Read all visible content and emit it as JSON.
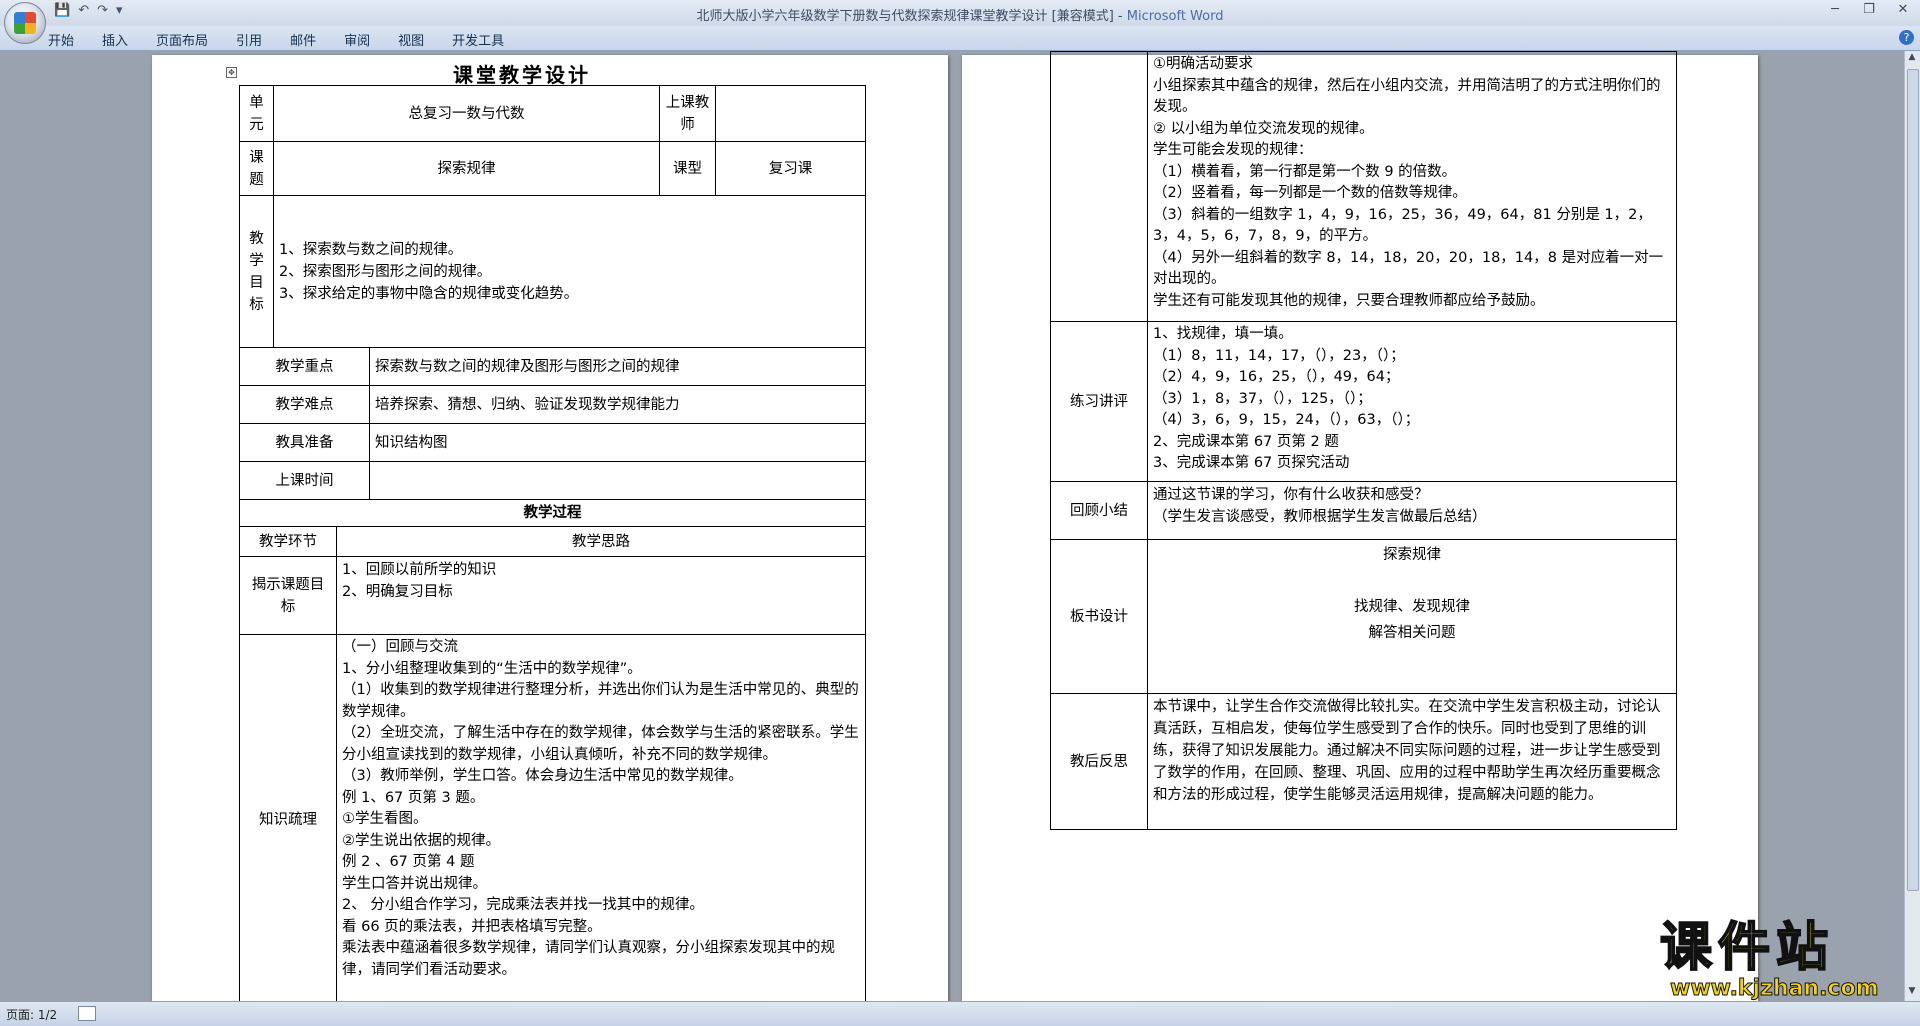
{
  "window": {
    "title": "北师大版小学六年级数学下册数与代数探索规律课堂教学设计 [兼容模式] - ",
    "app": "Microsoft Word"
  },
  "ribbon": {
    "tabs": [
      "开始",
      "插入",
      "页面布局",
      "引用",
      "邮件",
      "审阅",
      "视图",
      "开发工具"
    ]
  },
  "status": {
    "page": "页面: 1/2"
  },
  "watermark": {
    "brand": "课件站",
    "url": "www.kjzhan.com"
  },
  "doc": {
    "title": "课堂教学设计",
    "unit_label": "单元",
    "unit_value": "总复习一数与代数",
    "teacher_label": "上课教师",
    "topic_label": "课题",
    "topic_value": "探索规律",
    "type_label": "课型",
    "type_value": "复习课",
    "goal_label": "教学目标",
    "goals": [
      "1、探索数与数之间的规律。",
      "2、探索图形与图形之间的规律。",
      "3、探求给定的事物中隐含的规律或变化趋势。"
    ],
    "key_label": "教学重点",
    "key_value": "探索数与数之间的规律及图形与图形之间的规律",
    "difficult_label": "教学难点",
    "difficult_value": "培养探索、猜想、归纳、验证发现数学规律能力",
    "prep_label": "教具准备",
    "prep_value": "知识结构图",
    "time_label": "上课时间",
    "process_header": "教学过程",
    "stage_header": "教学环节",
    "idea_header": "教学思路",
    "s1_label": "揭示课题目标",
    "s1_lines": [
      "1、回顾以前所学的知识",
      "2、明确复习目标"
    ],
    "s2_label": "知识疏理",
    "s2_lines": [
      "（一）回顾与交流",
      "1、分小组整理收集到的“生活中的数学规律”。",
      "（1）收集到的数学规律进行整理分析，并选出你们认为是生活中常见的、典型的数学规律。",
      "（2）全班交流，了解生活中存在的数学规律，体会数学与生活的紧密联系。学生分小组宣读找到的数学规律，小组认真倾听，补充不同的数学规律。",
      "（3）教师举例，学生口答。体会身边生活中常见的数学规律。",
      "例 1、67 页第 3 题。",
      "①学生看图。",
      "②学生说出依据的规律。",
      "例 2 、67 页第 4 题",
      "学生口答并说出规律。",
      "2、 分小组合作学习，完成乘法表并找一找其中的规律。",
      "看 66 页的乘法表，并把表格填写完整。",
      "乘法表中蕴涵着很多数学规律，请同学们认真观察，分小组探索发现其中的规律，请同学们看活动要求。"
    ],
    "p2_first_lines": [
      "①明确活动要求",
      "小组探索其中蕴含的规律，然后在小组内交流，并用简洁明了的方式注明你们的发现。",
      "② 以小组为单位交流发现的规律。",
      "学生可能会发现的规律：",
      "（1）横着看，第一行都是第一个数 9 的倍数。",
      "（2）竖着看，每一列都是一个数的倍数等规律。",
      "（3）斜着的一组数字 1，4，9，16，25，36，49，64，81 分别是 1，2，3，4，5，6，7，8，9，的平方。",
      "（4）另外一组斜着的数字 8，14，18，20，20，18，14，8 是对应着一对一对出现的。",
      "学生还有可能发现其他的规律，只要合理教师都应给予鼓励。"
    ],
    "practice_label": "练习讲评",
    "practice_lines": [
      "1、找规律，填一填。",
      "（1）8，11，14，17，（），23，（）；",
      "（2）4，9，16，25，（），49，64；",
      "（3）1，8，37，（），125，（）；",
      "（4）3，6，9，15，24，（），63，（）；",
      "2、完成课本第 67 页第 2 题",
      "3、完成课本第 67 页探究活动"
    ],
    "review_label": "回顾小结",
    "review_lines": [
      "通过这节课的学习，你有什么收获和感受？",
      "（学生发言谈感受，教师根据学生发言做最后总结）"
    ],
    "board_label": "板书设计",
    "board_lines": [
      "探索规律",
      "找规律、发现规律",
      "解答相关问题"
    ],
    "reflect_label": "教后反思",
    "reflect_text": "本节课中，让学生合作交流做得比较扎实。在交流中学生发言积极主动，讨论认真活跃，互相启发，使每位学生感受到了合作的快乐。同时也受到了思维的训练，获得了知识发展能力。通过解决不同实际问题的过程，进一步让学生感受到了数学的作用，在回顾、整理、巩固、应用的过程中帮助学生再次经历重要概念和方法的形成过程，使学生能够灵活运用规律，提高解决问题的能力。"
  }
}
